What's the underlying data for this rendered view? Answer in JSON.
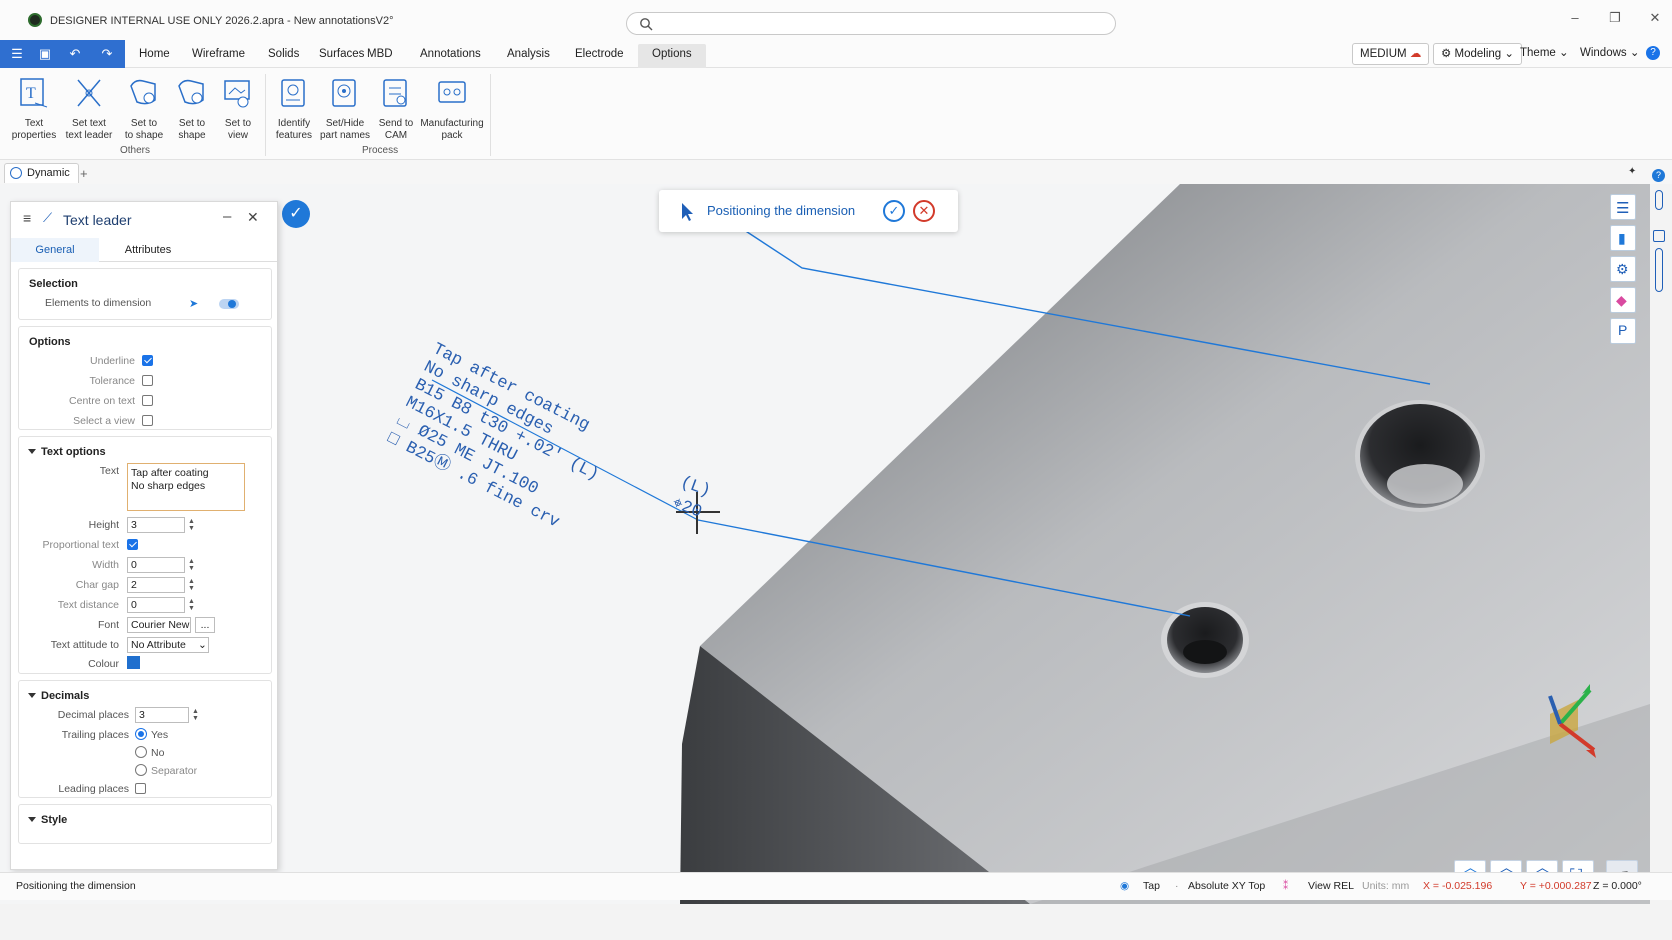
{
  "window": {
    "title": "DESIGNER INTERNAL USE ONLY 2026.2.apra - New annotationsV2°",
    "controls": [
      "–",
      "❐",
      "✕"
    ]
  },
  "ribbon": {
    "tabs": [
      "Home",
      "Wireframe",
      "Solids",
      "Surfaces",
      "MBD",
      "Annotations",
      "Analysis",
      "Electrode",
      "Options"
    ],
    "active_tab": "Options",
    "right": {
      "level": "MEDIUM",
      "mode": "Modeling",
      "theme": "Theme",
      "windows": "Windows"
    }
  },
  "toolbar": {
    "others": [
      {
        "label1": "Text",
        "label2": "properties",
        "icon": "text-properties-icon"
      },
      {
        "label1": "Set text",
        "label2": "text leader",
        "icon": "text-leader-icon"
      },
      {
        "label1": "Set to",
        "label2": "to shape",
        "icon": "set-to-shape-icon"
      },
      {
        "label1": "Set to",
        "label2": "shape",
        "icon": "set-shape-icon"
      },
      {
        "label1": "Set to",
        "label2": "view",
        "icon": "set-view-icon"
      }
    ],
    "others_group": "Others",
    "process": [
      {
        "label1": "Identify",
        "label2": "features",
        "icon": "identify-features-icon"
      },
      {
        "label1": "Set/Hide",
        "label2": "part names",
        "icon": "part-names-icon"
      },
      {
        "label1": "Send to",
        "label2": "CAM",
        "icon": "send-cam-icon"
      },
      {
        "label1": "Manufacturing",
        "label2": "pack",
        "icon": "manufacturing-pack-icon"
      }
    ],
    "process_group": "Process"
  },
  "doc_tab": {
    "label": "Dynamic",
    "add": "+"
  },
  "panel": {
    "title": "Text leader",
    "tabs": [
      "General",
      "Attributes"
    ],
    "selection": {
      "title": "Selection",
      "elements_label": "Elements to dimension"
    },
    "options": {
      "title": "Options",
      "underline": "Underline",
      "tolerance": "Tolerance",
      "centre": "Centre on text",
      "select_view": "Select a view"
    },
    "text_options": {
      "title": "Text options",
      "text_label": "Text",
      "text_line1": "Tap after coating",
      "text_line2": "No sharp edges",
      "height_label": "Height",
      "height": "3",
      "proportional_label": "Proportional text",
      "width_label": "Width",
      "width": "0",
      "chargap_label": "Char gap",
      "chargap": "2",
      "textdist_label": "Text distance",
      "textdist": "0",
      "font_label": "Font",
      "font": "Courier New",
      "font_more": "...",
      "attitude_label": "Text attitude to",
      "attitude": "No Attribute",
      "colour_label": "Colour",
      "colour": "#1f6fce"
    },
    "decimals": {
      "title": "Decimals",
      "places_label": "Decimal places",
      "places": "3",
      "trailing_label": "Trailing places",
      "yes": "Yes",
      "no": "No",
      "separator": "Separator",
      "leading_label": "Leading places"
    },
    "style": {
      "title": "Style"
    }
  },
  "prompt": {
    "text": "Positioning the dimension"
  },
  "annotation": {
    "lines": [
      "Tap after coating",
      "No sharp edges",
      "B15 B8 t30 +.02' (L)",
      "M16X1.5 THRU",
      "⌴ Ø25 ME JT.100",
      "□ B25Ⓜ .6 fine crv"
    ],
    "extra1": "(L)",
    "extra2": "⌖20"
  },
  "status": {
    "message": "Positioning the dimension",
    "tap": "Tap",
    "plane": "Absolute XY Top",
    "view": "View REL",
    "units": "Units: mm",
    "x": "X = -0.025.196",
    "y": "Y = +0.000.287",
    "z": "Z = 0.000°"
  }
}
